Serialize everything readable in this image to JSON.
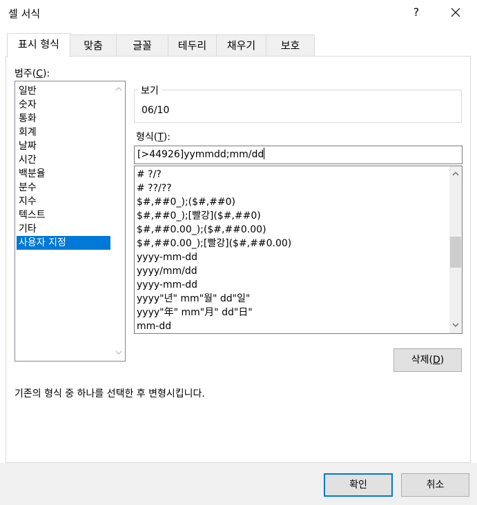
{
  "window": {
    "title": "셀 서식",
    "help_label": "?"
  },
  "tabs": [
    {
      "label": "표시 형식",
      "active": true
    },
    {
      "label": "맞춤",
      "active": false
    },
    {
      "label": "글꼴",
      "active": false
    },
    {
      "label": "테두리",
      "active": false
    },
    {
      "label": "채우기",
      "active": false
    },
    {
      "label": "보호",
      "active": false
    }
  ],
  "category": {
    "label_prefix": "범주(",
    "label_mnemonic": "C",
    "label_suffix": "):",
    "items": [
      "일반",
      "숫자",
      "통화",
      "회계",
      "날짜",
      "시간",
      "백분율",
      "분수",
      "지수",
      "텍스트",
      "기타",
      "사용자 지정"
    ],
    "selected_index": 11
  },
  "preview": {
    "legend": "보기",
    "value": "06/10"
  },
  "format": {
    "label_prefix": "형식(",
    "label_mnemonic": "T",
    "label_suffix": "):",
    "value": "[>44926]yymmdd;mm/dd",
    "list": [
      "# ?/?",
      "# ??/??",
      "$#,##0_);($#,##0)",
      "$#,##0_);[빨강]($#,##0)",
      "$#,##0.00_);($#,##0.00)",
      "$#,##0.00_);[빨강]($#,##0.00)",
      "yyyy-mm-dd",
      "yyyy/mm/dd",
      "yyyy-mm-dd",
      "yyyy\"년\" mm\"월\" dd\"일\"",
      "yyyy\"年\" mm\"月\" dd\"日\"",
      "mm-dd"
    ]
  },
  "delete_button": {
    "prefix": "삭제(",
    "mnemonic": "D",
    "suffix": ")"
  },
  "hint_text": "기존의 형식 중 하나를 선택한 후 변형시킵니다.",
  "footer": {
    "ok_label": "확인",
    "cancel_label": "취소"
  },
  "colors": {
    "selection": "#0078d7",
    "default_button_border": "#0078d7"
  }
}
